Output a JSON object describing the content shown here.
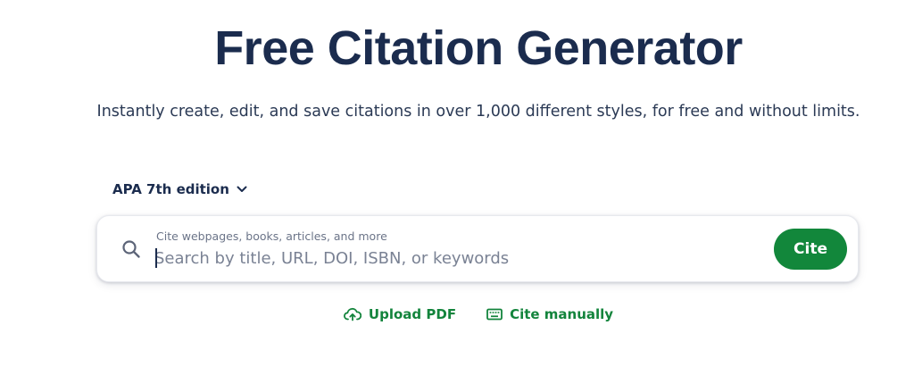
{
  "header": {
    "title": "Free Citation Generator",
    "subtitle": "Instantly create, edit, and save citations in over 1,000 different styles, for free and without limits."
  },
  "style_selector": {
    "selected": "APA 7th edition",
    "icon": "chevron-down-icon"
  },
  "search": {
    "icon": "search-icon",
    "caption": "Cite webpages, books, articles, and more",
    "placeholder": "Search by title, URL, DOI, ISBN, or keywords",
    "value": "",
    "button_label": "Cite"
  },
  "actions": {
    "upload_label": "Upload PDF",
    "upload_icon": "cloud-upload-icon",
    "manual_label": "Cite manually",
    "manual_icon": "keyboard-icon"
  },
  "colors": {
    "title": "#1b2c4e",
    "accent_green": "#12873b",
    "link_green": "#13843c",
    "muted_text": "#6b7488"
  }
}
